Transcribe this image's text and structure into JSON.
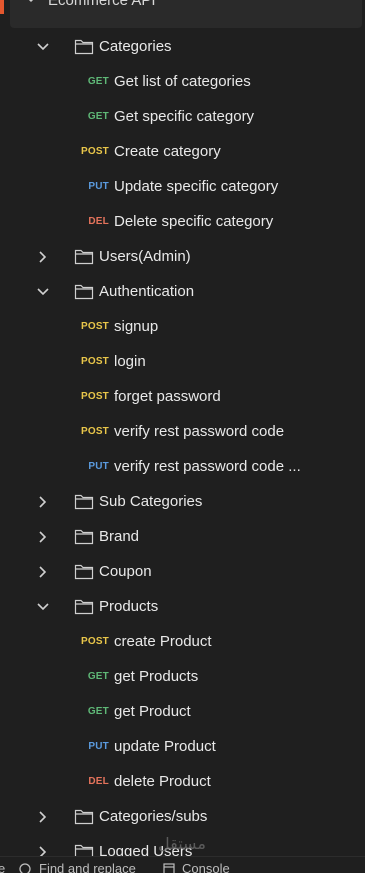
{
  "collection": {
    "name": "Ecommerce API",
    "accent_color": "#e4572e"
  },
  "method_colors": {
    "GET": "#5fb877",
    "POST": "#e9c64a",
    "PUT": "#5b9bdf",
    "DEL": "#e4735b"
  },
  "tree": [
    {
      "type": "folder",
      "label": "Categories",
      "expanded": true,
      "icon": "folder-icon"
    },
    {
      "type": "request",
      "method": "GET",
      "label": "Get list of categories"
    },
    {
      "type": "request",
      "method": "GET",
      "label": "Get specific category"
    },
    {
      "type": "request",
      "method": "POST",
      "label": "Create category"
    },
    {
      "type": "request",
      "method": "PUT",
      "label": "Update specific category"
    },
    {
      "type": "request",
      "method": "DEL",
      "label": "Delete specific category"
    },
    {
      "type": "folder",
      "label": "Users(Admin)",
      "expanded": false,
      "icon": "folder-icon"
    },
    {
      "type": "folder",
      "label": "Authentication",
      "expanded": true,
      "icon": "folder-icon"
    },
    {
      "type": "request",
      "method": "POST",
      "label": "signup"
    },
    {
      "type": "request",
      "method": "POST",
      "label": "login"
    },
    {
      "type": "request",
      "method": "POST",
      "label": "forget password"
    },
    {
      "type": "request",
      "method": "POST",
      "label": "verify rest password code"
    },
    {
      "type": "request",
      "method": "PUT",
      "label": "verify rest password code ..."
    },
    {
      "type": "folder",
      "label": "Sub Categories",
      "expanded": false,
      "icon": "folder-icon"
    },
    {
      "type": "folder",
      "label": "Brand",
      "expanded": false,
      "icon": "folder-icon"
    },
    {
      "type": "folder",
      "label": "Coupon",
      "expanded": false,
      "icon": "folder-icon"
    },
    {
      "type": "folder",
      "label": "Products",
      "expanded": true,
      "icon": "folder-icon"
    },
    {
      "type": "request",
      "method": "POST",
      "label": "create Product"
    },
    {
      "type": "request",
      "method": "GET",
      "label": "get Products"
    },
    {
      "type": "request",
      "method": "GET",
      "label": "get Product"
    },
    {
      "type": "request",
      "method": "PUT",
      "label": "update Product"
    },
    {
      "type": "request",
      "method": "DEL",
      "label": "delete Product"
    },
    {
      "type": "folder",
      "label": "Categories/subs",
      "expanded": false,
      "icon": "folder-icon"
    },
    {
      "type": "folder",
      "label": "Logged Users",
      "expanded": false,
      "icon": "folder-icon"
    }
  ],
  "statusbar": {
    "partial_left": "e",
    "find_replace": "Find and replace",
    "console": "Console"
  },
  "watermark": "مستقل"
}
